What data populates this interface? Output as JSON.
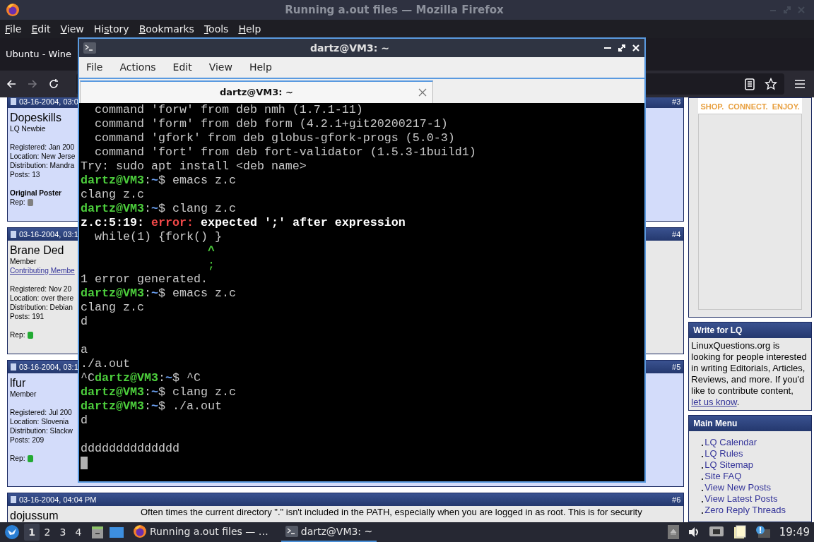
{
  "firefox": {
    "title": "Running a.out files — Mozilla Firefox",
    "menu": [
      {
        "accel": "F",
        "after": "ile"
      },
      {
        "accel": "E",
        "after": "dit"
      },
      {
        "accel": "V",
        "after": "iew"
      },
      {
        "before": "Hi",
        "accel": "s",
        "after": "tory"
      },
      {
        "accel": "B",
        "after": "ookmarks"
      },
      {
        "accel": "T",
        "after": "ools"
      },
      {
        "accel": "H",
        "after": "elp"
      }
    ],
    "tab": {
      "title": "Ubuntu - Wine"
    },
    "posts": [
      {
        "date": "03-16-2004, 03:0",
        "number_prefix": "#",
        "number": "3",
        "highlighted": true,
        "username": "Dopeskills",
        "rank": "LQ Newbie",
        "details": [
          "Registered: Jan 200",
          "Location: New Jerse",
          "Distribution: Mandra",
          "Posts: 13"
        ],
        "badge": "Original Poster",
        "rep": {
          "label": "Rep:",
          "color": "#808080"
        }
      },
      {
        "date": "03-16-2004, 03:1",
        "number_prefix": "#",
        "number": "4",
        "highlighted": false,
        "username": "Brane Ded",
        "rank": "Member",
        "title_link": "Contributing Membe",
        "details": [
          "Registered: Nov 20",
          "Location: over there",
          "Distribution: Debian",
          "Posts: 191"
        ],
        "rep": {
          "label": "Rep:",
          "color": "#22aa33"
        }
      },
      {
        "date": "03-16-2004, 03:1",
        "number_prefix": "#",
        "number": "5",
        "highlighted": true,
        "username": "lfur",
        "rank": "Member",
        "details": [
          "Registered: Jul 200",
          "Location: Slovenia",
          "Distribution: Slackw",
          "Posts: 209"
        ],
        "rep": {
          "label": "Rep:",
          "color": "#22aa33"
        }
      },
      {
        "date": "03-16-2004, 04:04 PM",
        "number_prefix": "#",
        "number": "6",
        "highlighted": false,
        "username": "dojussum",
        "message": "Often times the current directory \".\" isn't included in the PATH, especially when you are logged in as root. This is for security"
      }
    ],
    "sidebar": {
      "ad": {
        "slogan": "SHOP.  CONNECT.  ENJOY."
      },
      "write_box": {
        "title": "Write for LQ",
        "text": "LinuxQuestions.org is looking for people interested in writing Editorials, Articles, Reviews, and more. If you'd like to contribute content, ",
        "link": "let us know",
        "end": "."
      },
      "main_menu": {
        "title": "Main Menu",
        "items": [
          "LQ Calendar",
          "LQ Rules",
          "LQ Sitemap",
          "Site FAQ",
          "View New Posts",
          "View Latest Posts",
          "Zero Reply Threads"
        ]
      }
    }
  },
  "terminal": {
    "title": "dartz@VM3: ~",
    "menu": [
      "File",
      "Actions",
      "Edit",
      "View",
      "Help"
    ],
    "tabs": [
      {
        "title": "dartz@VM3: ~",
        "selected": true
      }
    ],
    "lines": [
      {
        "kind": "output",
        "segments": [
          {
            "kind": "text",
            "text": "  command 'forw' from deb nmh (1.7.1-11)"
          }
        ]
      },
      {
        "kind": "output",
        "segments": [
          {
            "kind": "text",
            "text": "  command 'form' from deb form (4.2.1+git20200217-1)"
          }
        ]
      },
      {
        "kind": "output",
        "segments": [
          {
            "kind": "text",
            "text": "  command 'gfork' from deb globus-gfork-progs (5.0-3)"
          }
        ]
      },
      {
        "kind": "output",
        "segments": [
          {
            "kind": "text",
            "text": "  command 'fort' from deb fort-validator (1.5.3-1build1)"
          }
        ]
      },
      {
        "kind": "output",
        "segments": [
          {
            "kind": "text",
            "text": "Try: sudo apt install <deb name>"
          }
        ]
      },
      {
        "kind": "output",
        "segments": [
          {
            "kind": "user",
            "text": "dartz@VM3"
          },
          {
            "kind": "text",
            "text": ":"
          },
          {
            "kind": "path",
            "text": "~"
          },
          {
            "kind": "text",
            "text": "$ emacs z.c"
          }
        ]
      },
      {
        "kind": "output",
        "segments": [
          {
            "kind": "text",
            "text": "clang z.c"
          }
        ]
      },
      {
        "kind": "output",
        "segments": [
          {
            "kind": "user",
            "text": "dartz@VM3"
          },
          {
            "kind": "text",
            "text": ":"
          },
          {
            "kind": "path",
            "text": "~"
          },
          {
            "kind": "text",
            "text": "$ clang z.c"
          }
        ]
      },
      {
        "kind": "output",
        "segments": [
          {
            "kind": "bold",
            "text": "z.c:5:19: "
          },
          {
            "kind": "error",
            "text": "error:"
          },
          {
            "kind": "bold",
            "text": " expected ';' after expression"
          }
        ]
      },
      {
        "kind": "output",
        "segments": [
          {
            "kind": "text",
            "text": "  while(1) {fork() }"
          }
        ]
      },
      {
        "kind": "output",
        "segments": [
          {
            "kind": "caret",
            "text": "                  ^"
          }
        ]
      },
      {
        "kind": "output",
        "segments": [
          {
            "kind": "hint",
            "text": "                  ;"
          }
        ]
      },
      {
        "kind": "output",
        "segments": [
          {
            "kind": "text",
            "text": "1 error generated."
          }
        ]
      },
      {
        "kind": "output",
        "segments": [
          {
            "kind": "user",
            "text": "dartz@VM3"
          },
          {
            "kind": "text",
            "text": ":"
          },
          {
            "kind": "path",
            "text": "~"
          },
          {
            "kind": "text",
            "text": "$ emacs z.c"
          }
        ]
      },
      {
        "kind": "output",
        "segments": [
          {
            "kind": "text",
            "text": "clang z.c"
          }
        ]
      },
      {
        "kind": "output",
        "segments": [
          {
            "kind": "text",
            "text": "d"
          }
        ]
      },
      {
        "kind": "blank"
      },
      {
        "kind": "output",
        "segments": [
          {
            "kind": "text",
            "text": "a"
          }
        ]
      },
      {
        "kind": "output",
        "segments": [
          {
            "kind": "text",
            "text": "./a.out"
          }
        ]
      },
      {
        "kind": "output",
        "segments": [
          {
            "kind": "text",
            "text": "^C"
          },
          {
            "kind": "user",
            "text": "dartz@VM3"
          },
          {
            "kind": "text",
            "text": ":"
          },
          {
            "kind": "path",
            "text": "~"
          },
          {
            "kind": "text",
            "text": "$ ^C"
          }
        ]
      },
      {
        "kind": "output",
        "segments": [
          {
            "kind": "user",
            "text": "dartz@VM3"
          },
          {
            "kind": "text",
            "text": ":"
          },
          {
            "kind": "path",
            "text": "~"
          },
          {
            "kind": "text",
            "text": "$ clang z.c"
          }
        ]
      },
      {
        "kind": "output",
        "segments": [
          {
            "kind": "user",
            "text": "dartz@VM3"
          },
          {
            "kind": "text",
            "text": ":"
          },
          {
            "kind": "path",
            "text": "~"
          },
          {
            "kind": "text",
            "text": "$ ./a.out"
          }
        ]
      },
      {
        "kind": "output",
        "segments": [
          {
            "kind": "text",
            "text": "d"
          }
        ]
      },
      {
        "kind": "blank"
      },
      {
        "kind": "output",
        "segments": [
          {
            "kind": "text",
            "text": "dddddddddddddd"
          }
        ]
      },
      {
        "kind": "cursor"
      }
    ]
  },
  "taskbar": {
    "workspaces": [
      {
        "label": "1",
        "selected": true
      },
      {
        "label": "2",
        "selected": false
      },
      {
        "label": "3",
        "selected": false
      },
      {
        "label": "4",
        "selected": false
      }
    ],
    "tasks": [
      {
        "kind": "browser",
        "label": "Running a.out files — …",
        "selected": false
      },
      {
        "kind": "terminal",
        "label": "dartz@VM3: ~",
        "selected": true
      }
    ],
    "clock": "19:49"
  }
}
